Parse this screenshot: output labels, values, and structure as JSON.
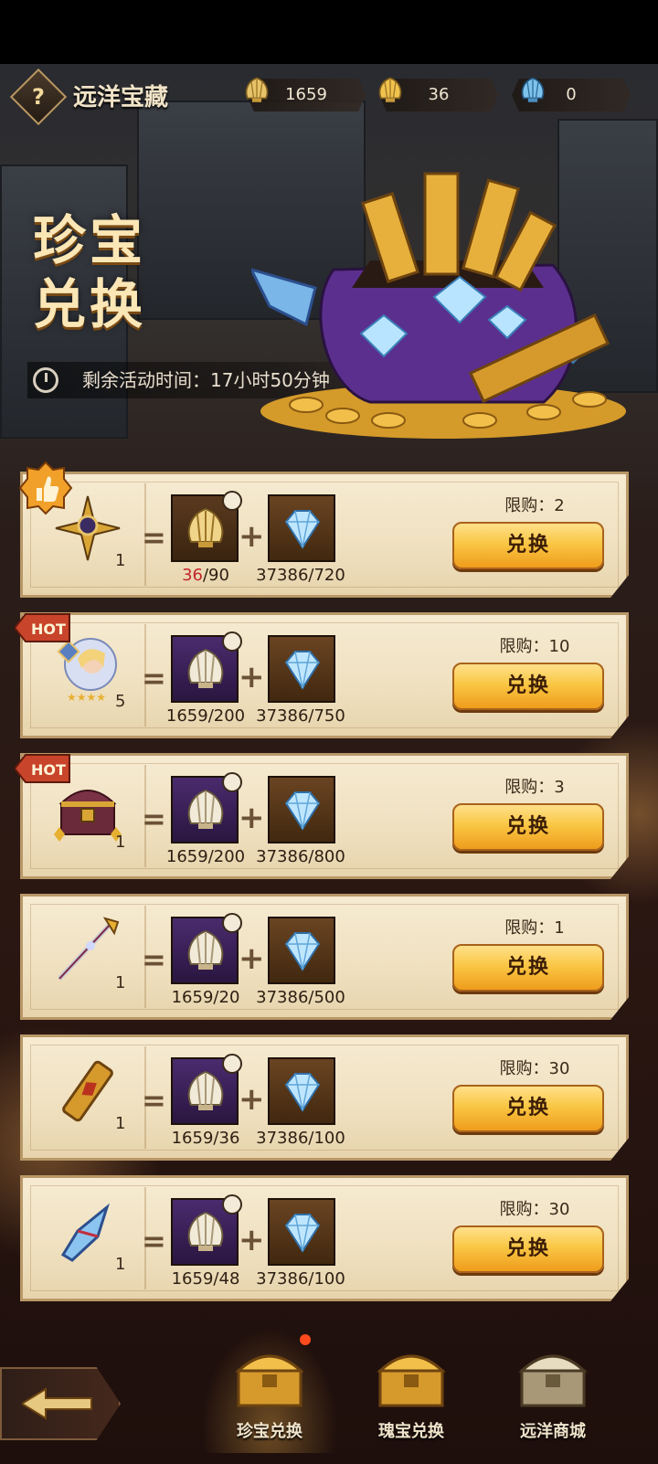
{
  "header": {
    "help_icon": "question-icon",
    "title": "远洋宝藏",
    "resources": [
      {
        "icon": "gold-shell-icon",
        "value": "1659"
      },
      {
        "icon": "gold-shell-icon",
        "value": "36"
      },
      {
        "icon": "blue-shell-icon",
        "value": "0"
      }
    ]
  },
  "banner": {
    "title_line1": "珍宝",
    "title_line2": "兑换",
    "timer_label": "剩余活动时间：17小时50分钟"
  },
  "rows": [
    {
      "badge": "thumbs-up",
      "reward_icon": "golden-emblem-icon",
      "reward_qty": "1",
      "cost1_have": "36",
      "cost1_need": "/90",
      "cost2": "37386/720",
      "limit": "限购：2",
      "button": "兑换"
    },
    {
      "badge": "HOT",
      "reward_icon": "hero-portrait-icon",
      "reward_qty": "5",
      "cost1_have": "1659",
      "cost1_need": "/200",
      "cost2": "37386/750",
      "limit": "限购：10",
      "button": "兑换"
    },
    {
      "badge": "HOT",
      "reward_icon": "treasure-chest-icon",
      "reward_qty": "1",
      "cost1_have": "1659",
      "cost1_need": "/200",
      "cost2": "37386/800",
      "limit": "限购：3",
      "button": "兑换"
    },
    {
      "badge": "",
      "reward_icon": "staff-weapon-icon",
      "reward_qty": "1",
      "cost1_have": "1659",
      "cost1_need": "/20",
      "cost2": "37386/500",
      "limit": "限购：1",
      "button": "兑换"
    },
    {
      "badge": "",
      "reward_icon": "scroll-icon",
      "reward_qty": "1",
      "cost1_have": "1659",
      "cost1_need": "/36",
      "cost2": "37386/100",
      "limit": "限购：30",
      "button": "兑换"
    },
    {
      "badge": "",
      "reward_icon": "crystal-shard-icon",
      "reward_qty": "1",
      "cost1_have": "1659",
      "cost1_need": "/48",
      "cost2": "37386/100",
      "limit": "限购：30",
      "button": "兑换"
    }
  ],
  "nav": {
    "back_icon": "back-arrow-icon",
    "items": [
      {
        "label": "珍宝兑换",
        "active": true
      },
      {
        "label": "瑰宝兑换",
        "active": false
      },
      {
        "label": "远洋商城",
        "active": false
      }
    ]
  },
  "colors": {
    "accent_gold": "#f9c744",
    "panel": "#f2e5c8",
    "limit_red": "#c2262a"
  }
}
